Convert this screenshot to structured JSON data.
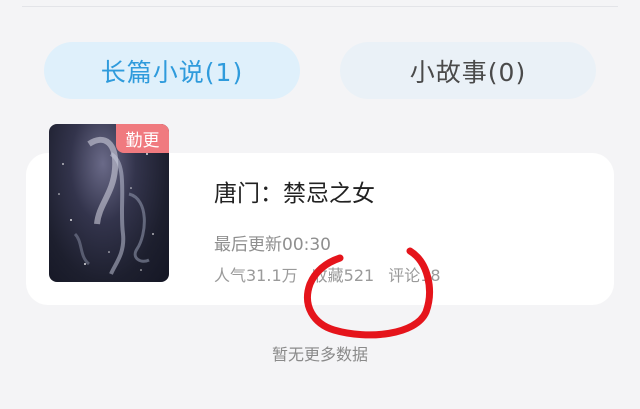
{
  "tabs": [
    {
      "label": "长篇小说(1)"
    },
    {
      "label": "小故事(0)"
    }
  ],
  "book": {
    "badge": "勤更",
    "title": "唐门：禁忌之女",
    "last_update": "最后更新00:30",
    "popularity": "人气31.1万",
    "favorites": "收藏521",
    "comments": "评论18"
  },
  "footer": {
    "no_more": "暂无更多数据"
  },
  "colors": {
    "accent_blue": "#2f9bdc",
    "badge_red": "#f07a7f",
    "annotation_red": "#e5141b"
  }
}
